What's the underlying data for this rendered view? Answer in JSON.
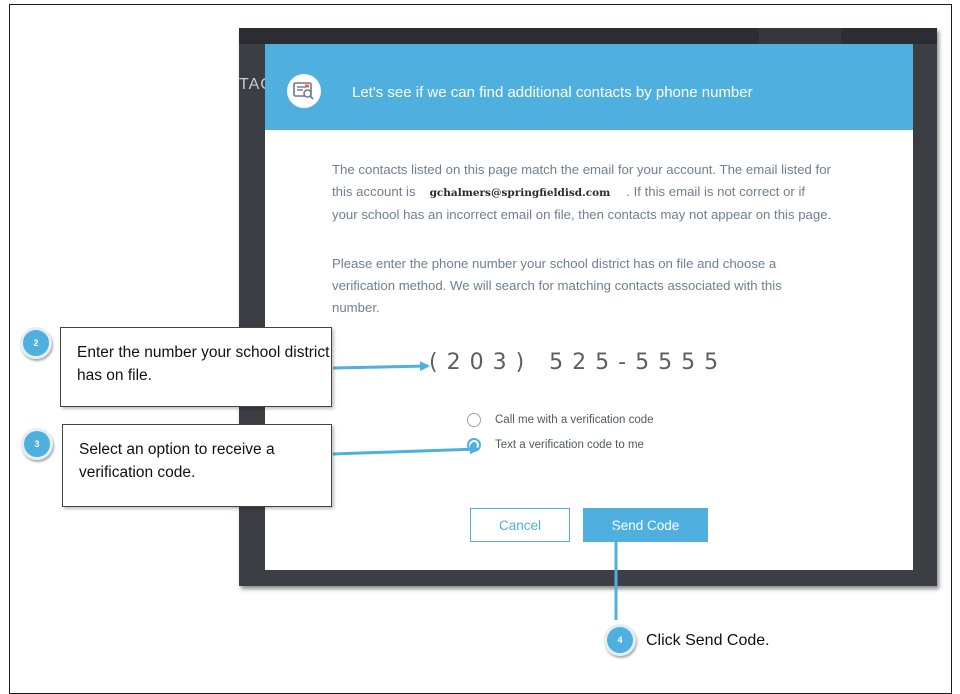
{
  "background": {
    "fragment_text": "TAC"
  },
  "modal": {
    "header_title": "Let's see if we can find additional contacts by phone number",
    "icon": "contact-card-search-icon",
    "paragraph1_before": "The contacts listed on this page match the email for your account. The email listed for this account is",
    "email": "gchalmers@springfieldisd.com",
    "paragraph1_after": ". If this email is not correct or if your school has an incorrect email on file, then contacts may not appear on this page.",
    "paragraph2": "Please enter the phone number your school district has on file and choose a verification method. We will search for matching contacts associated with this number.",
    "phone_value": "(203) 525-5555",
    "options": [
      {
        "label": "Call me with a verification code",
        "selected": false
      },
      {
        "label": "Text a verification code to me",
        "selected": true
      }
    ],
    "cancel_label": "Cancel",
    "send_label": "Send Code"
  },
  "callouts": {
    "step2_number": "2",
    "step2_text": "Enter the number your school district has on file.",
    "step3_number": "3",
    "step3_text": "Select an option to receive a verification code.",
    "step4_number": "4",
    "step4_text": "Click Send Code."
  },
  "colors": {
    "accent": "#4fb0e0",
    "backdrop": "#3b3f44",
    "body_text": "#6f8090"
  }
}
